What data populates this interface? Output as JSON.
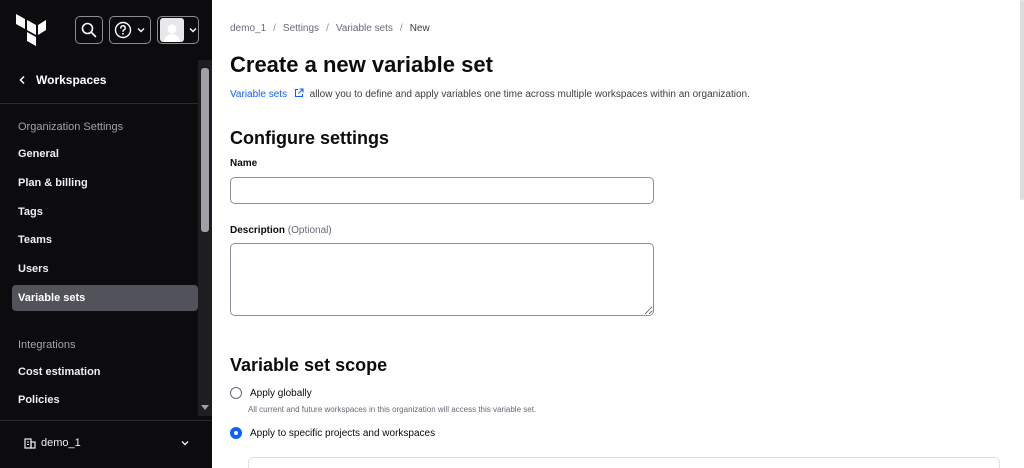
{
  "sidebar": {
    "back_label": "Workspaces",
    "section_org": "Organization Settings",
    "items": [
      {
        "label": "General"
      },
      {
        "label": "Plan & billing"
      },
      {
        "label": "Tags"
      },
      {
        "label": "Teams"
      },
      {
        "label": "Users"
      },
      {
        "label": "Variable sets",
        "active": true
      }
    ],
    "section_integrations": "Integrations",
    "integration_items": [
      {
        "label": "Cost estimation"
      },
      {
        "label": "Policies"
      }
    ],
    "org_name": "demo_1"
  },
  "breadcrumb": {
    "items": [
      "demo_1",
      "Settings",
      "Variable sets"
    ],
    "separator": "/",
    "current": "New"
  },
  "page": {
    "title": "Create a new variable set",
    "intro_link": "Variable sets",
    "intro_text": "allow you to define and apply variables one time across multiple workspaces within an organization."
  },
  "configure": {
    "heading": "Configure settings",
    "name_label": "Name",
    "name_value": "",
    "description_label": "Description",
    "description_optional": "(Optional)",
    "description_value": ""
  },
  "scope": {
    "heading": "Variable set scope",
    "option_global": "Apply globally",
    "option_global_help": "All current and future workspaces in this organization will access this variable set.",
    "option_specific": "Apply to specific projects and workspaces",
    "selected": "Apply to specific projects and workspaces"
  },
  "colors": {
    "sidebar_bg": "#0c0c0e",
    "link": "#1060ff",
    "active_item": "#52525b"
  }
}
